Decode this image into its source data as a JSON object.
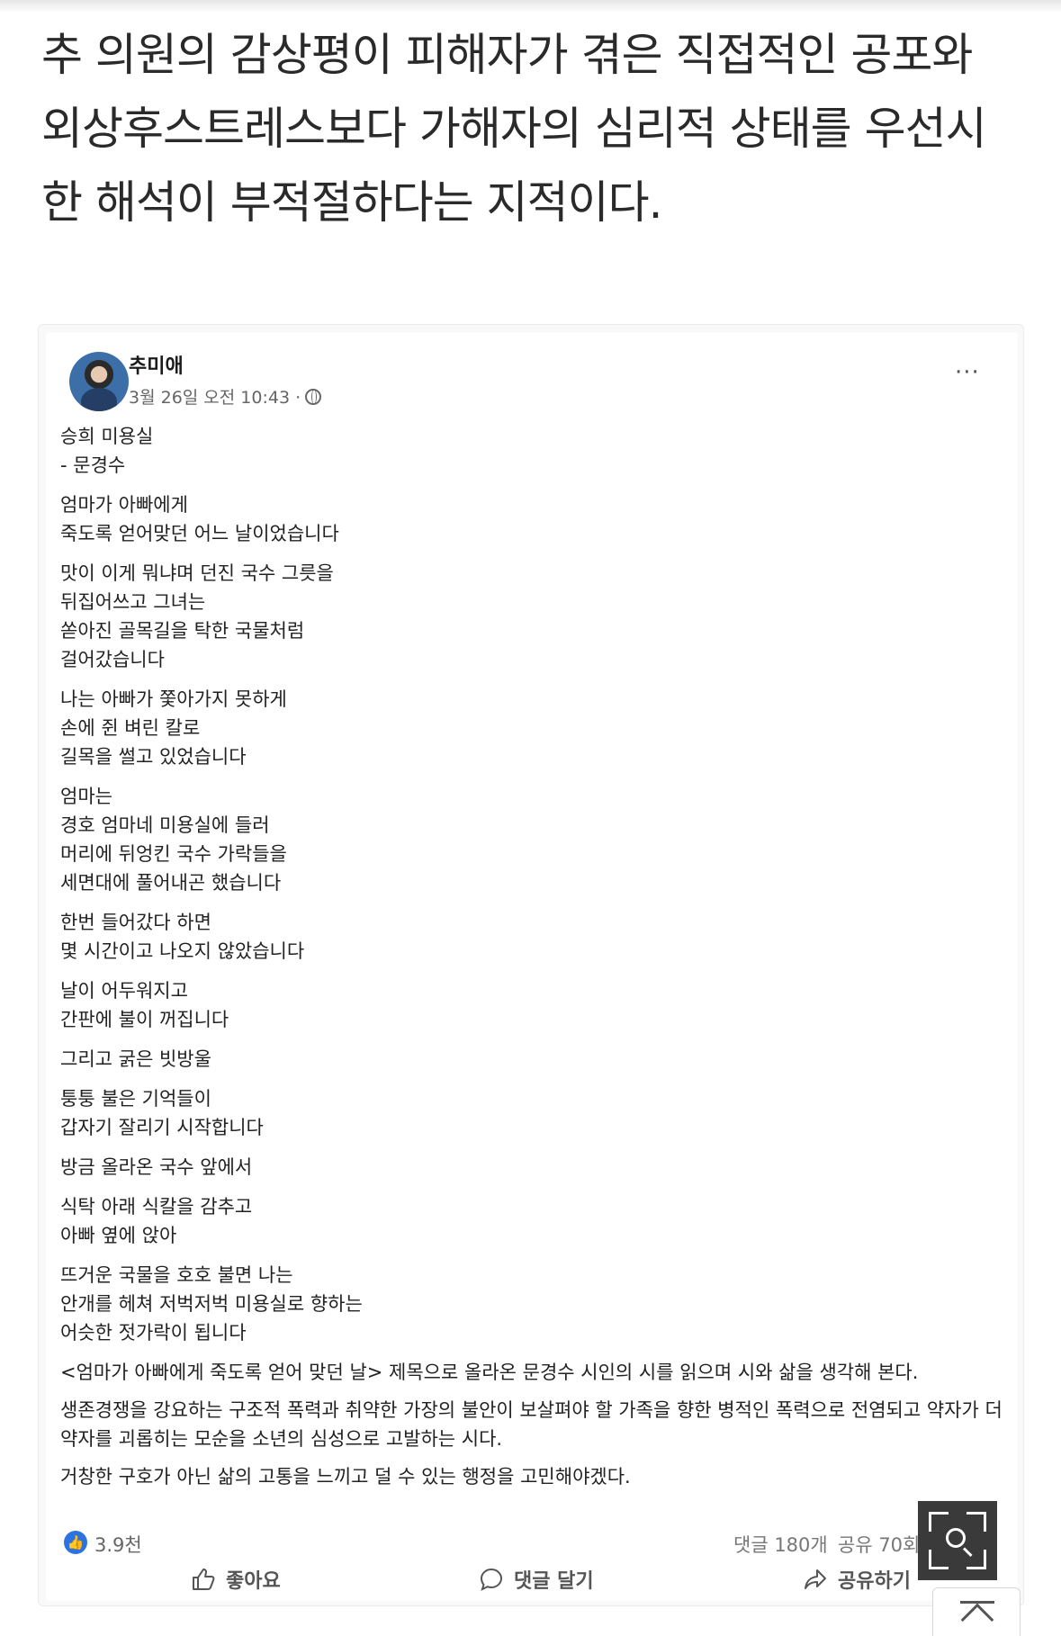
{
  "article": {
    "lines": [
      "추 의원의 감상평이 피해자가 겪은 직접적인 공포와",
      "외상후스트레스보다 가해자의 심리적 상태를 우선시",
      "한 해석이 부적절하다는 지적이다."
    ]
  },
  "post": {
    "author": "추미애",
    "timestamp": "3월 26일 오전 10:43 ·",
    "more_label": "···",
    "stanzas": [
      [
        "승희 미용실",
        "- 문경수"
      ],
      [
        "엄마가 아빠에게",
        "죽도록 얻어맞던 어느 날이었습니다"
      ],
      [
        "맛이 이게 뭐냐며 던진 국수 그릇을",
        "뒤집어쓰고 그녀는",
        "쏟아진 골목길을 탁한 국물처럼",
        "걸어갔습니다"
      ],
      [
        "나는 아빠가 쫓아가지 못하게",
        "손에 쥔 벼린 칼로",
        "길목을 썰고 있었습니다"
      ],
      [
        "엄마는",
        "경호 엄마네 미용실에 들러",
        "머리에 뒤엉킨 국수 가락들을",
        "세면대에 풀어내곤 했습니다"
      ],
      [
        "한번 들어갔다 하면",
        "몇 시간이고 나오지 않았습니다"
      ],
      [
        "날이 어두워지고",
        "간판에 불이 꺼집니다"
      ],
      [
        "그리고 굵은 빗방울"
      ],
      [
        "퉁퉁 불은 기억들이",
        "갑자기 잘리기 시작합니다"
      ],
      [
        "방금 올라온 국수 앞에서"
      ],
      [
        "식탁 아래 식칼을 감추고",
        "아빠 옆에 앉아"
      ],
      [
        "뜨거운 국물을 호호 불면 나는",
        "안개를 헤쳐 저벅저벅 미용실로 향하는",
        "어슷한 젓가락이 됩니다"
      ]
    ],
    "paragraphs": [
      "<엄마가 아빠에게 죽도록 얻어 맞던 날> 제목으로 올라온 문경수 시인의 시를 읽으며 시와 삶을 생각해 본다.",
      "생존경쟁을 강요하는 구조적 폭력과  취약한 가장의 불안이 보살펴야 할 가족을 향한 병적인 폭력으로 전염되고 약자가 더 약자를 괴롭히는  모순을 소년의 심성으로 고발하는 시다.",
      "거창한 구호가 아닌 삶의 고통을 느끼고 덜 수 있는 행정을 고민해야겠다."
    ],
    "stats": {
      "likes": "3.9천",
      "comments": "댓글 180개",
      "shares": "공유 70회"
    },
    "actions": {
      "like": "좋아요",
      "comment": "댓글 달기",
      "share": "공유하기"
    }
  },
  "icons": {
    "like_badge": "thumbs-up-icon",
    "zoom": "zoom-search-icon",
    "scroll_top": "scroll-to-top-icon"
  },
  "colors": {
    "like_blue": "#2d73e0",
    "zoom_bg": "#3a3a3a"
  }
}
